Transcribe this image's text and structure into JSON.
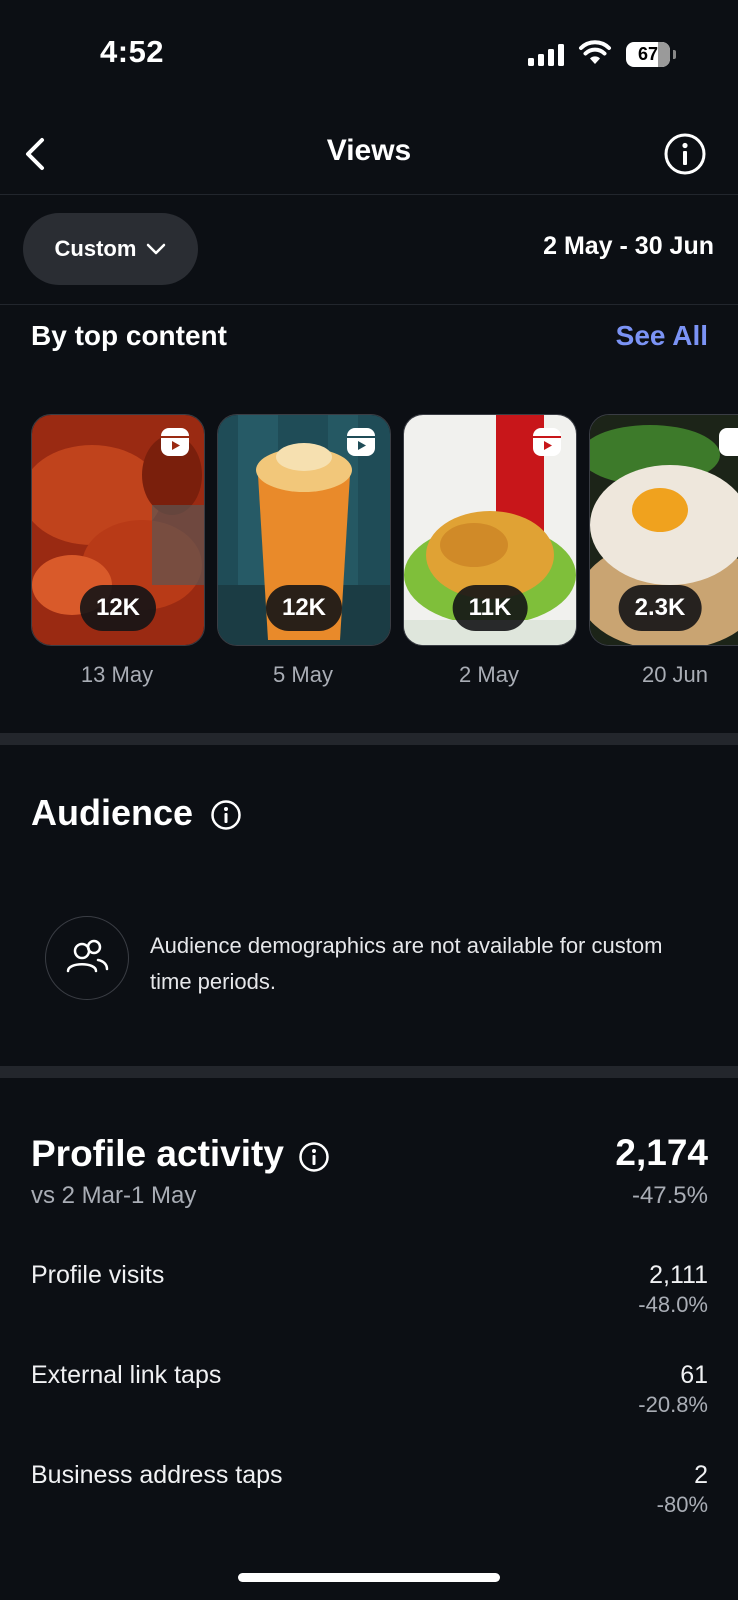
{
  "status_bar": {
    "time": "4:52",
    "battery": "67"
  },
  "nav": {
    "title": "Views"
  },
  "filter": {
    "label": "Custom",
    "date_range": "2 May - 30 Jun"
  },
  "top_content": {
    "title": "By top content",
    "see_all": "See All",
    "items": [
      {
        "views": "12K",
        "date": "13 May"
      },
      {
        "views": "12K",
        "date": "5 May"
      },
      {
        "views": "11K",
        "date": "2 May"
      },
      {
        "views": "2.3K",
        "date": "20 Jun"
      }
    ]
  },
  "audience": {
    "title": "Audience",
    "message": "Audience demographics are not available for custom time periods."
  },
  "profile_activity": {
    "title": "Profile activity",
    "comparison": "vs 2 Mar-1 May",
    "total": "2,174",
    "total_change": "-47.5%",
    "metrics": [
      {
        "label": "Profile visits",
        "value": "2,111",
        "change": "-48.0%"
      },
      {
        "label": "External link taps",
        "value": "61",
        "change": "-20.8%"
      },
      {
        "label": "Business address taps",
        "value": "2",
        "change": "-80%"
      }
    ]
  },
  "colors": {
    "background": "#0c0f14",
    "link": "#7b93f5",
    "secondary_text": "#a9adb5"
  }
}
